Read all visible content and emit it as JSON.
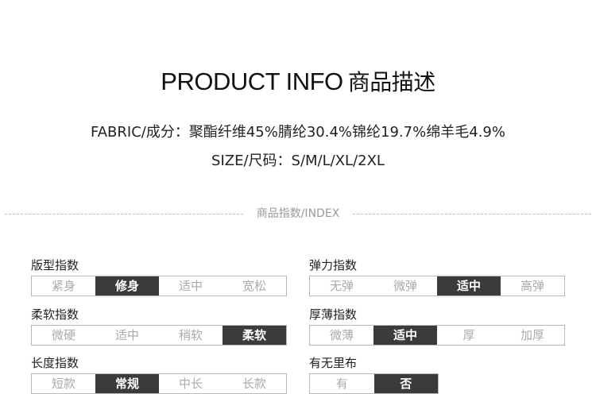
{
  "header": {
    "title_en": "PRODUCT INFO",
    "title_cn": "商品描述"
  },
  "fabric_line": "FABRIC/成分：聚酯纤维45%腈纶30.4%锦纶19.7%绵羊毛4.9%",
  "size_line": "SIZE/尺码：S/M/L/XL/2XL",
  "divider_label": "商品指数/INDEX",
  "indices": {
    "fit": {
      "title": "版型指数",
      "options": [
        "紧身",
        "修身",
        "适中",
        "宽松"
      ],
      "selected": "修身"
    },
    "elasticity": {
      "title": "弹力指数",
      "options": [
        "无弹",
        "微弹",
        "适中",
        "高弹"
      ],
      "selected": "适中"
    },
    "softness": {
      "title": "柔软指数",
      "options": [
        "微硬",
        "适中",
        "稍软",
        "柔软"
      ],
      "selected": "柔软"
    },
    "thickness": {
      "title": "厚薄指数",
      "options": [
        "微薄",
        "适中",
        "厚",
        "加厚"
      ],
      "selected": "适中"
    },
    "length": {
      "title": "长度指数",
      "options": [
        "短款",
        "常规",
        "中长",
        "长款"
      ],
      "selected": "常规"
    },
    "lining": {
      "title": "有无里布",
      "options": [
        "有",
        "否"
      ],
      "selected": "否"
    }
  },
  "colors": {
    "selected_bg": "#3b3b3b",
    "selected_text": "#ffffff",
    "unselected_text": "#aaaaaa",
    "border": "#b8b8b8"
  }
}
